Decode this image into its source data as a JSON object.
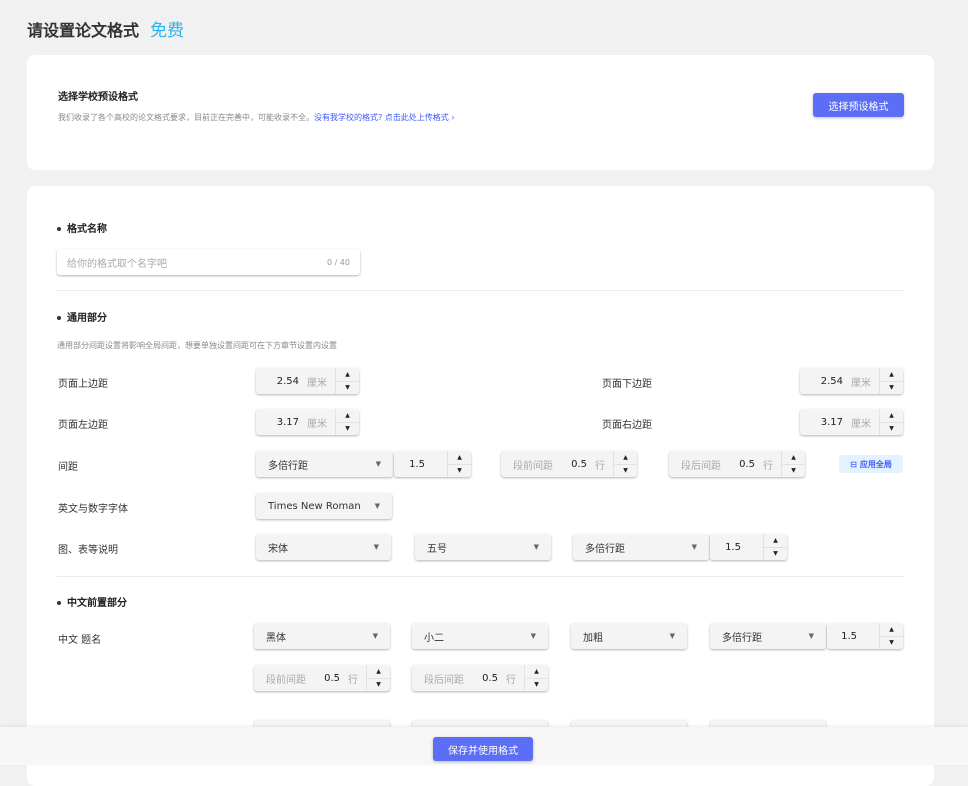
{
  "header": {
    "title": "请设置论文格式",
    "badge": "免费"
  },
  "preset": {
    "heading": "选择学校预设格式",
    "desc": "我们收录了各个高校的论文格式要求，目前正在完善中，可能收录不全。",
    "link": "没有我学校的格式? 点击此处上传格式 ›",
    "button": "选择预设格式"
  },
  "name": {
    "heading": "格式名称",
    "placeholder": "给你的格式取个名字吧",
    "counter": "0 / 40"
  },
  "general": {
    "heading": "通用部分",
    "note": "通用部分间距设置将影响全局间距，想要单独设置间距可在下方章节设置内设置",
    "top_label": "页面上边距",
    "top": "2.54",
    "bottom_label": "页面下边距",
    "bottom": "2.54",
    "left_label": "页面左边距",
    "left": "3.17",
    "right_label": "页面右边距",
    "right": "3.17",
    "unit": "厘米",
    "spacing_label": "间距",
    "spacing_mode": "多倍行距",
    "spacing_value": "1.5",
    "before_label": "段前间距",
    "before": "0.5",
    "after_label": "段后间距",
    "after": "0.5",
    "line_unit": "行",
    "apply_all": "应用全局",
    "font_label": "英文与数字字体",
    "font": "Times New Roman",
    "caption_label": "图、表等说明",
    "caption_font": "宋体",
    "caption_size": "五号",
    "caption_mode": "多倍行距",
    "caption_value": "1.5"
  },
  "front": {
    "heading": "中文前置部分",
    "title_label": "中文 题名",
    "font": "黑体",
    "size": "小二",
    "weight": "加粗",
    "mode": "多倍行距",
    "value": "1.5",
    "before_label": "段前间距",
    "before": "0.5",
    "after_label": "段后间距",
    "after": "0.5",
    "line_unit": "行"
  },
  "footer": {
    "save": "保存并使用格式"
  },
  "icons": {
    "up": "▲",
    "down": "▼",
    "caret": "▼",
    "apply": "⊟"
  }
}
